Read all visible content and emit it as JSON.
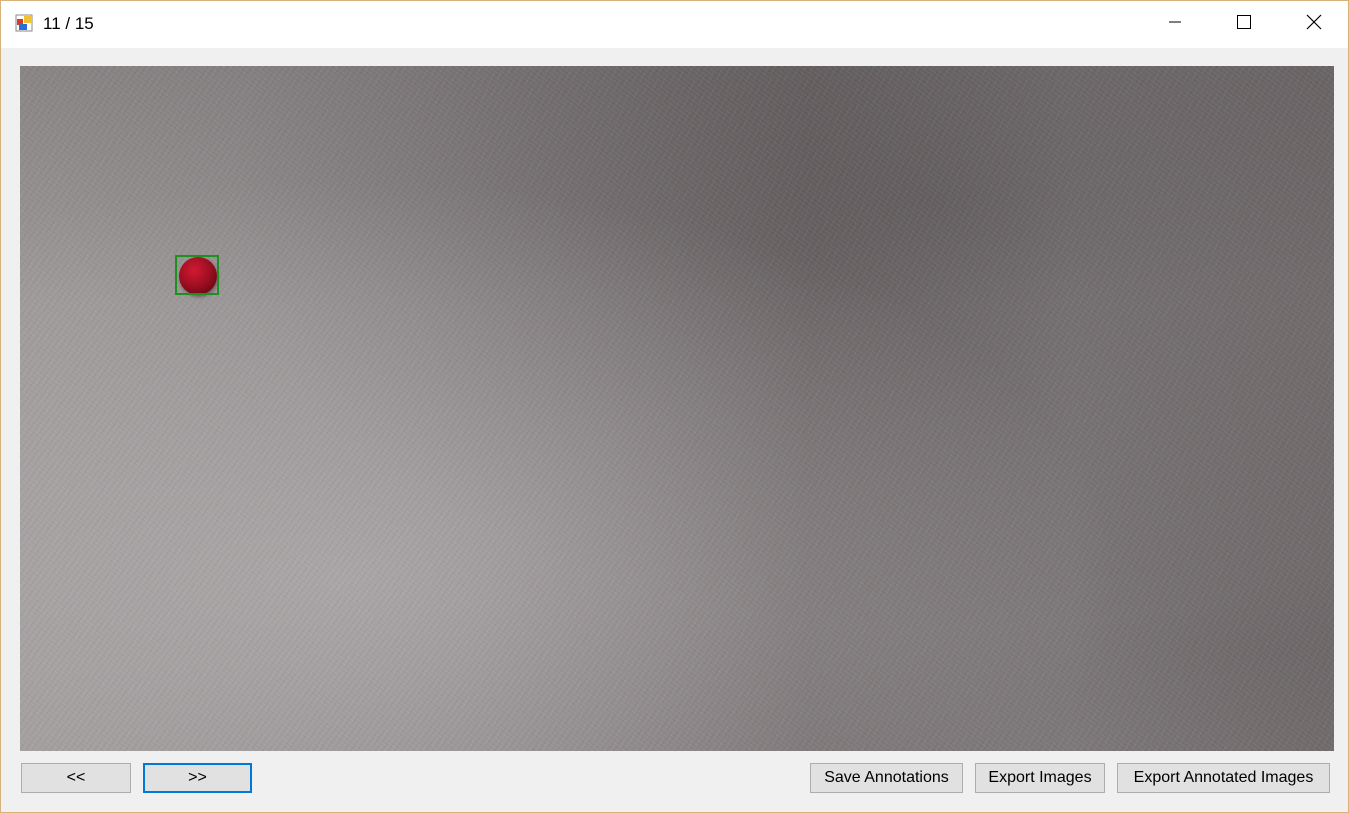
{
  "window": {
    "title": "11 / 15",
    "app_icon": "winforms-app-icon",
    "controls": {
      "minimize_icon": "minimize-icon",
      "maximize_icon": "maximize-icon",
      "close_icon": "close-icon"
    }
  },
  "toolbar": {
    "prev_label": "<<",
    "next_label": ">>",
    "save_label": "Save Annotations",
    "export_label": "Export Images",
    "export_annotated_label": "Export Annotated Images"
  },
  "colors": {
    "annotation_box": "#1f8f1f",
    "focus_border": "#0078d7",
    "button_face": "#e1e1e1"
  }
}
